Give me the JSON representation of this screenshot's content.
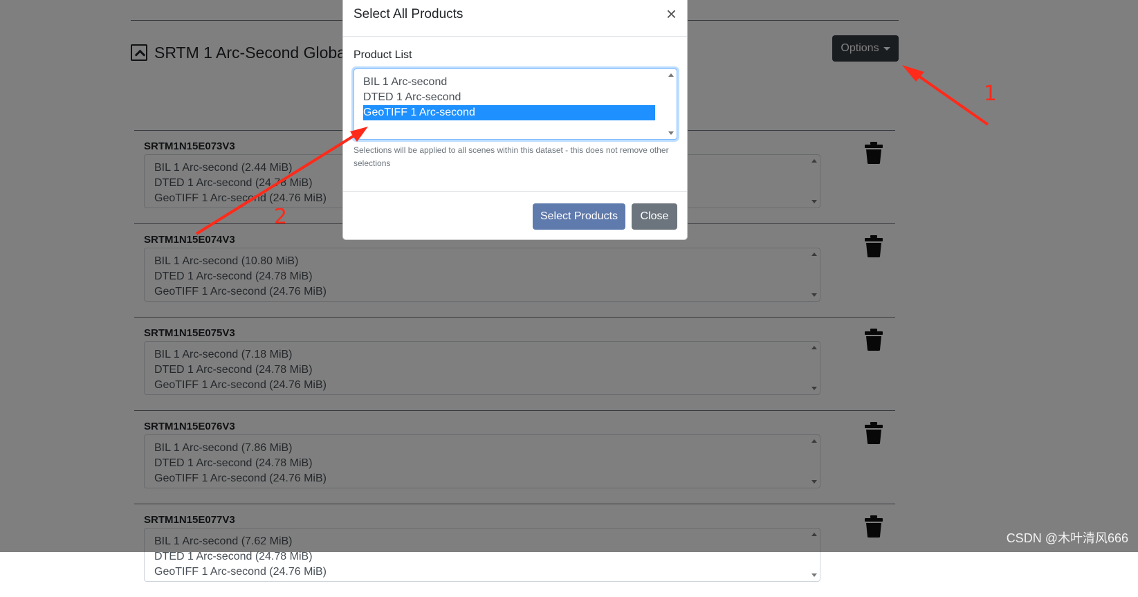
{
  "dataset": {
    "title": "SRTM 1 Arc-Second Global",
    "options_label": "Options"
  },
  "scenes": [
    {
      "name": "SRTM1N15E073V3",
      "products": [
        "BIL 1 Arc-second (2.44 MiB)",
        "DTED 1 Arc-second (24.78 MiB)",
        "GeoTIFF 1 Arc-second (24.76 MiB)"
      ]
    },
    {
      "name": "SRTM1N15E074V3",
      "products": [
        "BIL 1 Arc-second (10.80 MiB)",
        "DTED 1 Arc-second (24.78 MiB)",
        "GeoTIFF 1 Arc-second (24.76 MiB)"
      ]
    },
    {
      "name": "SRTM1N15E075V3",
      "products": [
        "BIL 1 Arc-second (7.18 MiB)",
        "DTED 1 Arc-second (24.78 MiB)",
        "GeoTIFF 1 Arc-second (24.76 MiB)"
      ]
    },
    {
      "name": "SRTM1N15E076V3",
      "products": [
        "BIL 1 Arc-second (7.86 MiB)",
        "DTED 1 Arc-second (24.78 MiB)",
        "GeoTIFF 1 Arc-second (24.76 MiB)"
      ]
    },
    {
      "name": "SRTM1N15E077V3",
      "products": [
        "BIL 1 Arc-second (7.62 MiB)",
        "DTED 1 Arc-second (24.78 MiB)",
        "GeoTIFF 1 Arc-second (24.76 MiB)"
      ]
    }
  ],
  "modal": {
    "title": "Select All Products",
    "close_glyph": "×",
    "field_label": "Product List",
    "options": [
      "BIL 1 Arc-second",
      "DTED 1 Arc-second",
      "GeoTIFF 1 Arc-second"
    ],
    "selected_option": "GeoTIFF 1 Arc-second",
    "help_text": "Selections will be applied to all scenes within this dataset - this does not remove other selections",
    "select_button": "Select Products",
    "close_button": "Close"
  },
  "annotations": {
    "label_1": "1",
    "label_2": "2",
    "color": "#ff2a1a"
  },
  "watermark": "CSDN @木叶清风666",
  "colors": {
    "selected_option_bg": "#1e90ff",
    "select_button_bg": "#5f7aad",
    "close_button_bg": "#6c757d",
    "options_button_bg": "#343a40"
  },
  "icons": {
    "scene_action": "trash-icon",
    "dataset_toggle": "collapse-up-icon"
  }
}
